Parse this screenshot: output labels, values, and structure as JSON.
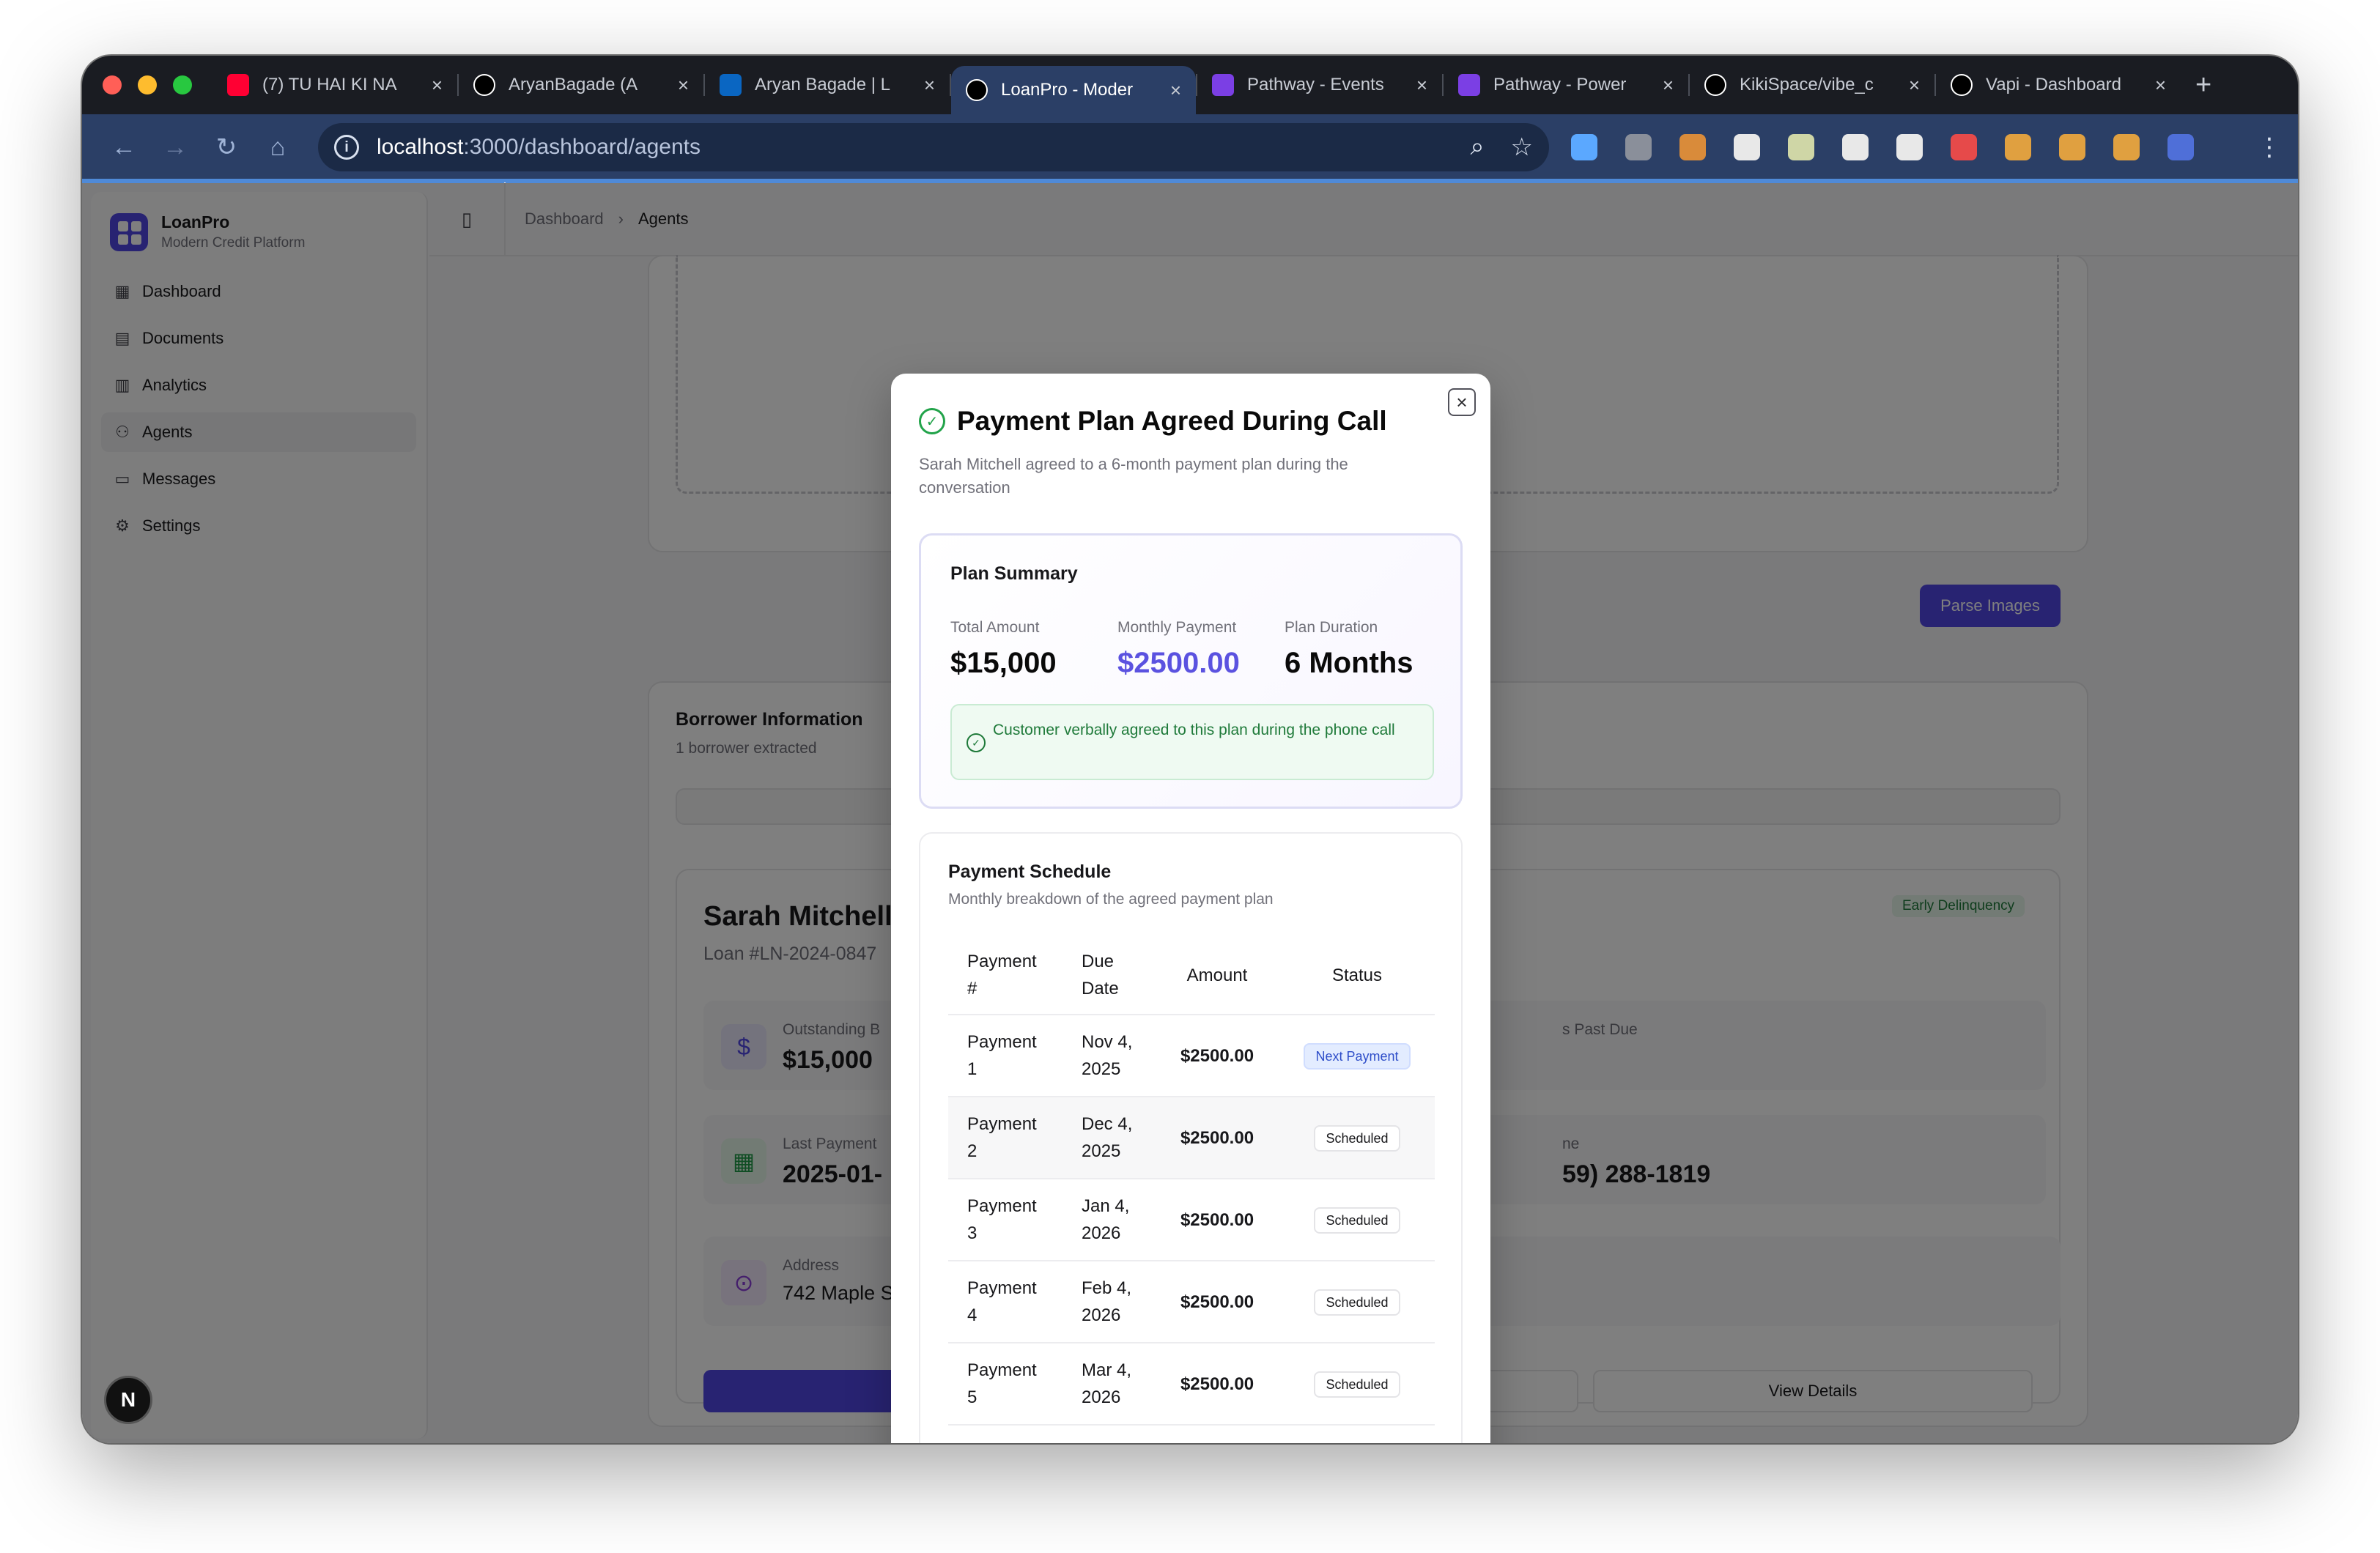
{
  "browser": {
    "tabs": [
      {
        "title": "(7) TU HAI KI NA",
        "favicon": "youtube-icon",
        "color": "#ff0033",
        "active": false
      },
      {
        "title": "AryanBagade (A",
        "favicon": "github-icon",
        "color": "#ffffff",
        "active": false
      },
      {
        "title": "Aryan Bagade | L",
        "favicon": "linkedin-icon",
        "color": "#0a66c2",
        "active": false
      },
      {
        "title": "LoanPro - Moder",
        "favicon": "vercel-icon",
        "color": "#ffffff",
        "active": true
      },
      {
        "title": "Pathway - Events",
        "favicon": "pathway-icon",
        "color": "#7b3fe4",
        "active": false
      },
      {
        "title": "Pathway - Power",
        "favicon": "pathway-icon",
        "color": "#7b3fe4",
        "active": false
      },
      {
        "title": "KikiSpace/vibe_c",
        "favicon": "github-icon",
        "color": "#ffffff",
        "active": false
      },
      {
        "title": "Vapi - Dashboard",
        "favicon": "vapi-icon",
        "color": "#ffffff",
        "active": false
      }
    ],
    "url_host": "localhost",
    "url_path": ":3000/dashboard/agents",
    "extension_colors": [
      "#5ba8ff",
      "#8a8f9a",
      "#d98b3a",
      "#e8e8e8",
      "#cfd6a6",
      "#e8e8e8",
      "#e8e8e8",
      "#e64a4a",
      "#e0a040",
      "#e0a040",
      "#e0a040",
      "#4f6fd8"
    ]
  },
  "sidebar": {
    "brand_name": "LoanPro",
    "brand_sub": "Modern Credit Platform",
    "items": [
      {
        "label": "Dashboard",
        "icon": "grid-icon",
        "active": false
      },
      {
        "label": "Documents",
        "icon": "document-icon",
        "active": false
      },
      {
        "label": "Analytics",
        "icon": "bar-chart-icon",
        "active": false
      },
      {
        "label": "Agents",
        "icon": "users-icon",
        "active": true
      },
      {
        "label": "Messages",
        "icon": "message-icon",
        "active": false
      },
      {
        "label": "Settings",
        "icon": "gear-icon",
        "active": false
      }
    ]
  },
  "breadcrumb": {
    "root": "Dashboard",
    "current": "Agents"
  },
  "background": {
    "parse_button": "Parse Images",
    "borrower_title": "Borrower Information",
    "borrower_sub": "1 borrower extracted",
    "name": "Sarah Mitchell",
    "loan": "Loan #LN-2024-0847",
    "status_badge": "Early Delinquency",
    "stats": [
      {
        "label": "Outstanding B",
        "value": "$15,000",
        "icon": "dollar-icon"
      },
      {
        "label": "s Past Due",
        "value": "",
        "icon": ""
      },
      {
        "label": "Last Payment",
        "value": "2025-01-",
        "icon": "calendar-icon"
      },
      {
        "label": "ne",
        "value": "59) 288-1819",
        "icon": ""
      },
      {
        "label": "Address",
        "value": "742 Maple S",
        "icon": "location-icon"
      }
    ],
    "view_details": "View Details",
    "next_badge": "N"
  },
  "modal": {
    "title": "Payment Plan Agreed During Call",
    "description": "Sarah Mitchell agreed to a 6-month payment plan during the conversation",
    "summary": {
      "title": "Plan Summary",
      "total_label": "Total Amount",
      "total_value": "$15,000",
      "monthly_label": "Monthly Payment",
      "monthly_value": "$2500.00",
      "duration_label": "Plan Duration",
      "duration_value": "6 Months",
      "agreement": "Customer verbally agreed to this plan during the phone call",
      "accent_color": "#5b52e0"
    },
    "schedule": {
      "title": "Payment Schedule",
      "subtitle": "Monthly breakdown of the agreed payment plan",
      "headers": [
        "Payment #",
        "Due Date",
        "Amount",
        "Status"
      ],
      "rows": [
        {
          "payment": "Payment 1",
          "due": "Nov 4, 2025",
          "amount": "$2500.00",
          "status": "Next Payment"
        },
        {
          "payment": "Payment 2",
          "due": "Dec 4, 2025",
          "amount": "$2500.00",
          "status": "Scheduled"
        },
        {
          "payment": "Payment 3",
          "due": "Jan 4, 2026",
          "amount": "$2500.00",
          "status": "Scheduled"
        },
        {
          "payment": "Payment 4",
          "due": "Feb 4, 2026",
          "amount": "$2500.00",
          "status": "Scheduled"
        },
        {
          "payment": "Payment 5",
          "due": "Mar 4, 2026",
          "amount": "$2500.00",
          "status": "Scheduled"
        }
      ]
    }
  }
}
